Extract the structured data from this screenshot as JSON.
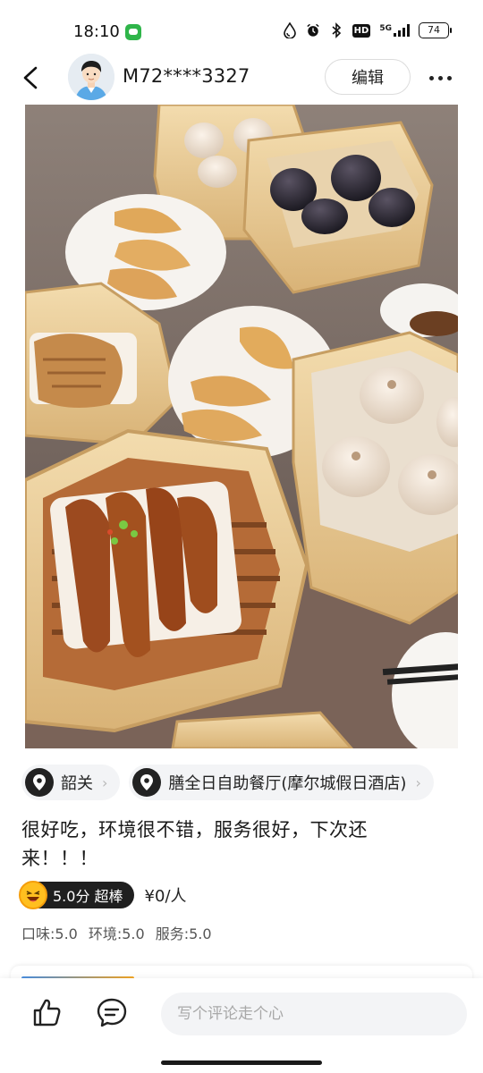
{
  "status_bar": {
    "time": "18:10",
    "network": "5G",
    "hd": "HD",
    "battery": "74"
  },
  "header": {
    "username": "M72****3327",
    "edit_label": "编辑"
  },
  "tags": {
    "city": "韶关",
    "restaurant": "膳全日自助餐厅(摩尔城假日酒店)"
  },
  "review": {
    "text": "很好吃，环境很不错，服务很好，下次还来！！！",
    "score_label": "5.0分 超棒",
    "price": "¥0/人",
    "sub_scores": [
      "口味:5.0",
      "环境:5.0",
      "服务:5.0"
    ]
  },
  "bottom_bar": {
    "comment_placeholder": "写个评论走个心"
  },
  "colors": {
    "badge_bg": "#1f1f1f",
    "tag_bg": "#f3f4f6",
    "notification_green": "#2fb54a",
    "emoji_yellow": "#ffbf1f"
  }
}
